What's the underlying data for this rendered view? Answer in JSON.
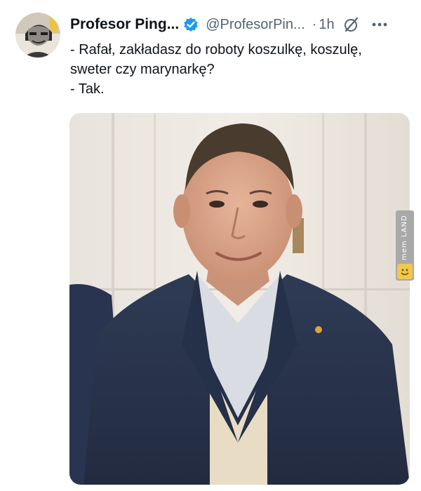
{
  "tweet": {
    "author": {
      "name": "Profesor Ping...",
      "handle": "@ProfesorPin...",
      "verified": true,
      "avatar_icon": "avatar-icon"
    },
    "time_separator": "·",
    "time": "1h",
    "text_lines": [
      "- Rafał, zakładasz do roboty koszulkę, koszulę,",
      "sweter czy marynarkę?",
      "- Tak."
    ],
    "media": {
      "type": "photo",
      "description_icon": "photo-of-man-in-blazer"
    },
    "watermark": {
      "text": "mem LAND"
    }
  },
  "colors": {
    "text_primary": "#0f1419",
    "text_secondary": "#536471",
    "verified_blue": "#1d9bf0",
    "background": "#ffffff"
  }
}
